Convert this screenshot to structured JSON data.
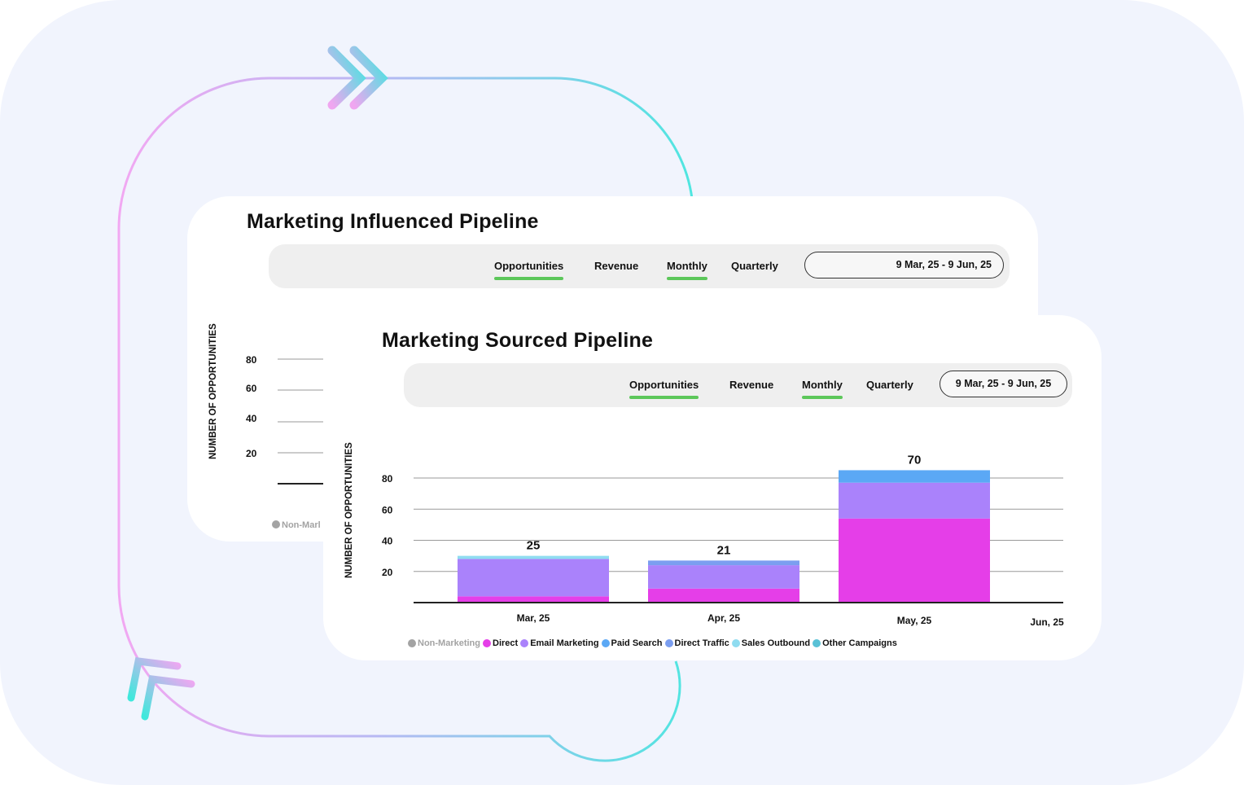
{
  "colors": {
    "background": "#f1f4fd",
    "card": "#ffffff",
    "accent_tab": "#5cc75a",
    "non_marketing": "#a3a3a3",
    "direct": "#e53ee8",
    "email_marketing": "#aa82fb",
    "paid_search": "#5ba8f5",
    "direct_traffic": "#7b9ef0",
    "sales_outbound": "#8fdcf0",
    "other_campaigns": "#59c1d6"
  },
  "influenced": {
    "title": "Marketing Influenced Pipeline",
    "tabs": [
      {
        "label": "Opportunities",
        "active": true
      },
      {
        "label": "Revenue",
        "active": false
      },
      {
        "label": "Monthly",
        "active": true
      },
      {
        "label": "Quarterly",
        "active": false
      }
    ],
    "date_range": "9 Mar, 25 - 9 Jun, 25",
    "ylabel": "NUMBER OF OPPORTUNITIES",
    "y_ticks": [
      "80",
      "60",
      "40",
      "20"
    ],
    "legend_first": "Non-Marl"
  },
  "sourced": {
    "title": "Marketing Sourced Pipeline",
    "tabs": [
      {
        "label": "Opportunities",
        "active": true
      },
      {
        "label": "Revenue",
        "active": false
      },
      {
        "label": "Monthly",
        "active": true
      },
      {
        "label": "Quarterly",
        "active": false
      }
    ],
    "date_range": "9 Mar, 25 - 9 Jun, 25",
    "legend": [
      {
        "label": "Non-Marketing",
        "color": "#a3a3a3",
        "muted": true
      },
      {
        "label": "Direct",
        "color": "#e53ee8"
      },
      {
        "label": "Email Marketing",
        "color": "#aa82fb"
      },
      {
        "label": "Paid Search",
        "color": "#5ba8f5"
      },
      {
        "label": "Direct Traffic",
        "color": "#7b9ef0"
      },
      {
        "label": "Sales Outbound",
        "color": "#8fdcf0"
      },
      {
        "label": "Other Campaigns",
        "color": "#59c1d6"
      }
    ]
  },
  "chart_data": {
    "type": "bar",
    "stacked": true,
    "categories": [
      "Mar, 25",
      "Apr, 25",
      "May, 25",
      "Jun, 25"
    ],
    "ylabel": "NUMBER OF OPPORTUNITIES",
    "y_ticks": [
      80,
      60,
      40,
      20
    ],
    "ylim": [
      0,
      80
    ],
    "grid": true,
    "legend_position": "bottom-left",
    "series": [
      {
        "name": "Direct",
        "color": "#e53ee8",
        "values": [
          4,
          9,
          54,
          0
        ]
      },
      {
        "name": "Email Marketing",
        "color": "#aa82fb",
        "values": [
          24,
          15,
          23,
          0
        ]
      },
      {
        "name": "Paid Search",
        "color": "#5ba8f5",
        "values": [
          0,
          0,
          8,
          0
        ]
      },
      {
        "name": "Direct Traffic",
        "color": "#7b9ef0",
        "values": [
          0,
          3,
          0,
          0
        ]
      },
      {
        "name": "Sales Outbound",
        "color": "#8fdcf0",
        "values": [
          2,
          0,
          0,
          0
        ]
      }
    ],
    "totals": [
      "25",
      "21",
      "70",
      ""
    ]
  }
}
